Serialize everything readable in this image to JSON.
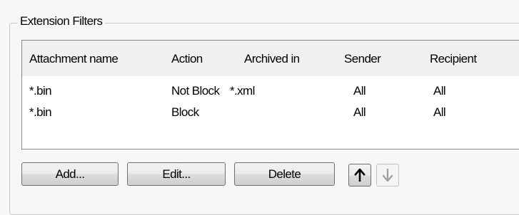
{
  "group": {
    "title": "Extension Filters"
  },
  "table": {
    "columns": [
      "Attachment name",
      "Action",
      "Archived in",
      "Sender",
      "Recipient"
    ],
    "rows": [
      [
        "*.bin",
        "Not Block",
        "*.xml",
        "All",
        "All"
      ],
      [
        "*.bin",
        "Block",
        "",
        "All",
        "All"
      ]
    ]
  },
  "buttons": {
    "add": "Add...",
    "edit": "Edit...",
    "delete": "Delete",
    "move_up_icon": "arrow-up-icon",
    "move_down_icon": "arrow-down-icon"
  },
  "colors": {
    "arrow_enabled": "#000000",
    "arrow_disabled": "#9d9d9d"
  }
}
